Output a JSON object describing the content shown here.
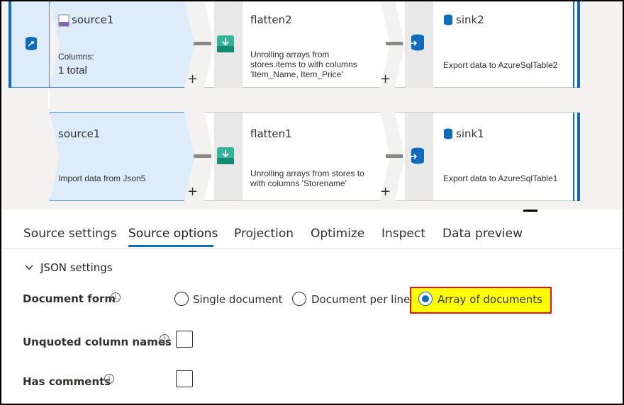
{
  "pipeline": {
    "row1": {
      "source": {
        "title": "source1",
        "columns_label": "Columns:",
        "columns_value": "1 total",
        "icon": "json-file-icon"
      },
      "flatten": {
        "title": "flatten2",
        "description_l1": "Unrolling arrays from",
        "description_l2": "stores.items to  with columns",
        "description_l3": "'Item_Name, Item_Price'",
        "icon": "flatten-icon"
      },
      "sink": {
        "title": "sink2",
        "description": "Export data to AzureSqlTable2",
        "icon": "sql-icon"
      }
    },
    "row2": {
      "source": {
        "title": "source1",
        "description": "Import data from Json5"
      },
      "flatten": {
        "title": "flatten1",
        "description_l1": "Unrolling arrays from stores to",
        "description_l2": "with columns 'Storename'",
        "icon": "flatten-icon"
      },
      "sink": {
        "title": "sink1",
        "description": "Export data to AzureSqlTable1",
        "icon": "sql-icon"
      }
    },
    "plus": "+"
  },
  "tabs": [
    {
      "label": "Source settings",
      "active": false
    },
    {
      "label": "Source options",
      "active": true
    },
    {
      "label": "Projection",
      "active": false
    },
    {
      "label": "Optimize",
      "active": false
    },
    {
      "label": "Inspect",
      "active": false
    },
    {
      "label": "Data preview",
      "active": false
    }
  ],
  "json_settings": {
    "section_title": "JSON settings",
    "document_form": {
      "label": "Document form",
      "options": [
        {
          "label": "Single document",
          "selected": false
        },
        {
          "label": "Document per line",
          "selected": false
        },
        {
          "label": "Array of documents",
          "selected": true
        }
      ]
    },
    "unquoted_column_names": {
      "label": "Unquoted column names",
      "checked": false
    },
    "has_comments": {
      "label": "Has comments",
      "checked": false
    },
    "info_glyph": "i"
  },
  "colors": {
    "accent": "#0f6cbd",
    "highlight_fill": "#ffff00",
    "highlight_border": "#e81123"
  }
}
